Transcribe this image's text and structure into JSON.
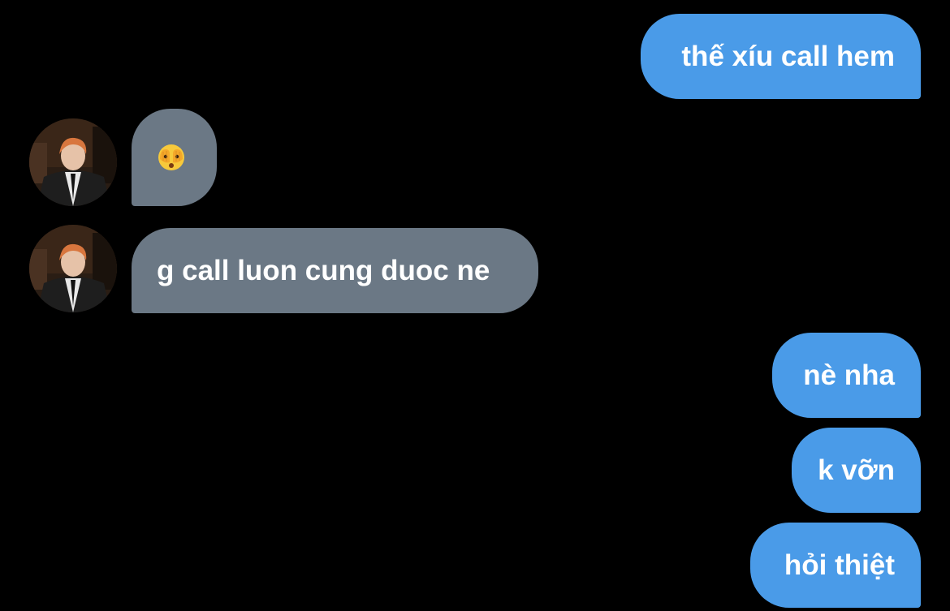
{
  "conversation": {
    "messages": [
      {
        "sender": "me",
        "text": "thế xíu call hem"
      },
      {
        "sender": "contact",
        "text": "🫣"
      },
      {
        "sender": "contact",
        "text": "g call luon cung duoc ne"
      },
      {
        "sender": "me",
        "text": "nè nha"
      },
      {
        "sender": "me",
        "text": "k vỡn"
      },
      {
        "sender": "me",
        "text": "hỏi thiệt"
      }
    ],
    "contact_avatar": "contact-photo-avatar",
    "emoji_icon": "face-with-peeking-eye-icon"
  },
  "colors": {
    "background": "#000000",
    "outgoing_bubble": "#4a9be8",
    "incoming_bubble": "#6b7885",
    "text": "#ffffff"
  }
}
